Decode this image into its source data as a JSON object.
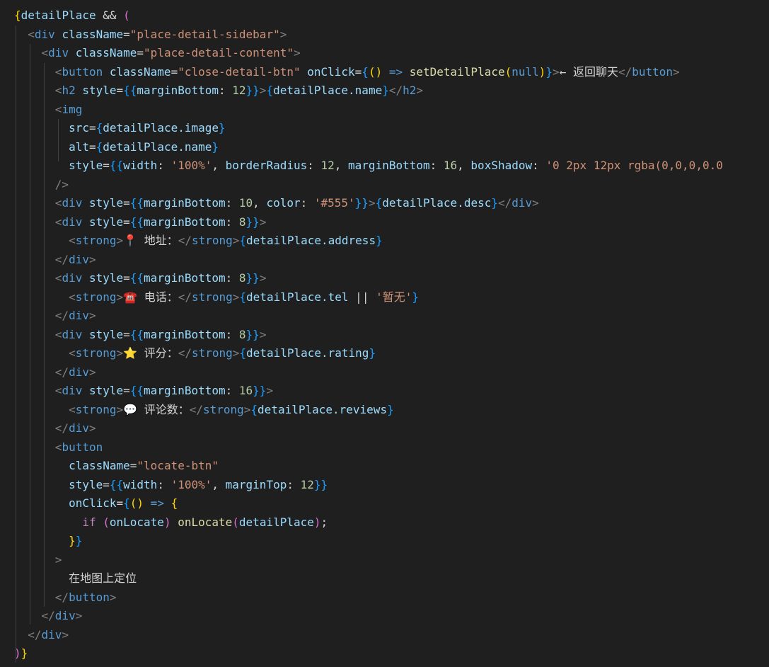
{
  "editor": {
    "lines": [
      [
        {
          "t": "{",
          "c": "tok-bracket-gold"
        },
        {
          "t": "detailPlace",
          "c": "tok-var"
        },
        {
          "t": " && ",
          "c": "tok-op"
        },
        {
          "t": "(",
          "c": "tok-bracket-pink"
        }
      ],
      [
        {
          "t": "  "
        },
        {
          "t": "<",
          "c": "tok-punct"
        },
        {
          "t": "div",
          "c": "tok-tag"
        },
        {
          "t": " className",
          "c": "tok-attr"
        },
        {
          "t": "=",
          "c": "tok-op"
        },
        {
          "t": "\"place-detail-sidebar\"",
          "c": "tok-str"
        },
        {
          "t": ">",
          "c": "tok-punct"
        }
      ],
      [
        {
          "t": "    "
        },
        {
          "t": "<",
          "c": "tok-punct"
        },
        {
          "t": "div",
          "c": "tok-tag"
        },
        {
          "t": " className",
          "c": "tok-attr"
        },
        {
          "t": "=",
          "c": "tok-op"
        },
        {
          "t": "\"place-detail-content\"",
          "c": "tok-str"
        },
        {
          "t": ">",
          "c": "tok-punct"
        }
      ],
      [
        {
          "t": "      "
        },
        {
          "t": "<",
          "c": "tok-punct"
        },
        {
          "t": "button",
          "c": "tok-tag"
        },
        {
          "t": " className",
          "c": "tok-attr"
        },
        {
          "t": "=",
          "c": "tok-op"
        },
        {
          "t": "\"close-detail-btn\"",
          "c": "tok-str"
        },
        {
          "t": " onClick",
          "c": "tok-attr"
        },
        {
          "t": "=",
          "c": "tok-op"
        },
        {
          "t": "{",
          "c": "tok-bracket-blue"
        },
        {
          "t": "()",
          "c": "tok-bracket-gold"
        },
        {
          "t": " => ",
          "c": "tok-null"
        },
        {
          "t": "setDetailPlace",
          "c": "tok-fn"
        },
        {
          "t": "(",
          "c": "tok-bracket-gold"
        },
        {
          "t": "null",
          "c": "tok-null"
        },
        {
          "t": ")",
          "c": "tok-bracket-gold"
        },
        {
          "t": "}",
          "c": "tok-bracket-blue"
        },
        {
          "t": ">",
          "c": "tok-punct"
        },
        {
          "t": "← 返回聊天",
          "c": "tok-text"
        },
        {
          "t": "</",
          "c": "tok-punct"
        },
        {
          "t": "button",
          "c": "tok-tag"
        },
        {
          "t": ">",
          "c": "tok-punct"
        }
      ],
      [
        {
          "t": "      "
        },
        {
          "t": "<",
          "c": "tok-punct"
        },
        {
          "t": "h2",
          "c": "tok-tag"
        },
        {
          "t": " style",
          "c": "tok-attr"
        },
        {
          "t": "=",
          "c": "tok-op"
        },
        {
          "t": "{{",
          "c": "tok-bracket-blue"
        },
        {
          "t": "marginBottom",
          "c": "tok-var"
        },
        {
          "t": ": ",
          "c": "tok-op"
        },
        {
          "t": "12",
          "c": "tok-num"
        },
        {
          "t": "}}",
          "c": "tok-bracket-blue"
        },
        {
          "t": ">",
          "c": "tok-punct"
        },
        {
          "t": "{",
          "c": "tok-bracket-blue"
        },
        {
          "t": "detailPlace.name",
          "c": "tok-var"
        },
        {
          "t": "}",
          "c": "tok-bracket-blue"
        },
        {
          "t": "</",
          "c": "tok-punct"
        },
        {
          "t": "h2",
          "c": "tok-tag"
        },
        {
          "t": ">",
          "c": "tok-punct"
        }
      ],
      [
        {
          "t": "      "
        },
        {
          "t": "<",
          "c": "tok-punct"
        },
        {
          "t": "img",
          "c": "tok-tag"
        }
      ],
      [
        {
          "t": "        "
        },
        {
          "t": "src",
          "c": "tok-attr"
        },
        {
          "t": "=",
          "c": "tok-op"
        },
        {
          "t": "{",
          "c": "tok-bracket-blue"
        },
        {
          "t": "detailPlace.image",
          "c": "tok-var"
        },
        {
          "t": "}",
          "c": "tok-bracket-blue"
        }
      ],
      [
        {
          "t": "        "
        },
        {
          "t": "alt",
          "c": "tok-attr"
        },
        {
          "t": "=",
          "c": "tok-op"
        },
        {
          "t": "{",
          "c": "tok-bracket-blue"
        },
        {
          "t": "detailPlace.name",
          "c": "tok-var"
        },
        {
          "t": "}",
          "c": "tok-bracket-blue"
        }
      ],
      [
        {
          "t": "        "
        },
        {
          "t": "style",
          "c": "tok-attr"
        },
        {
          "t": "=",
          "c": "tok-op"
        },
        {
          "t": "{{",
          "c": "tok-bracket-blue"
        },
        {
          "t": "width",
          "c": "tok-var"
        },
        {
          "t": ": ",
          "c": "tok-op"
        },
        {
          "t": "'100%'",
          "c": "tok-str"
        },
        {
          "t": ", ",
          "c": "tok-op"
        },
        {
          "t": "borderRadius",
          "c": "tok-var"
        },
        {
          "t": ": ",
          "c": "tok-op"
        },
        {
          "t": "12",
          "c": "tok-num"
        },
        {
          "t": ", ",
          "c": "tok-op"
        },
        {
          "t": "marginBottom",
          "c": "tok-var"
        },
        {
          "t": ": ",
          "c": "tok-op"
        },
        {
          "t": "16",
          "c": "tok-num"
        },
        {
          "t": ", ",
          "c": "tok-op"
        },
        {
          "t": "boxShadow",
          "c": "tok-var"
        },
        {
          "t": ": ",
          "c": "tok-op"
        },
        {
          "t": "'0 2px 12px rgba(0,0,0,0.0",
          "c": "tok-str"
        }
      ],
      [
        {
          "t": "      "
        },
        {
          "t": "/>",
          "c": "tok-punct"
        }
      ],
      [
        {
          "t": "      "
        },
        {
          "t": "<",
          "c": "tok-punct"
        },
        {
          "t": "div",
          "c": "tok-tag"
        },
        {
          "t": " style",
          "c": "tok-attr"
        },
        {
          "t": "=",
          "c": "tok-op"
        },
        {
          "t": "{{",
          "c": "tok-bracket-blue"
        },
        {
          "t": "marginBottom",
          "c": "tok-var"
        },
        {
          "t": ": ",
          "c": "tok-op"
        },
        {
          "t": "10",
          "c": "tok-num"
        },
        {
          "t": ", ",
          "c": "tok-op"
        },
        {
          "t": "color",
          "c": "tok-var"
        },
        {
          "t": ": ",
          "c": "tok-op"
        },
        {
          "t": "'#555'",
          "c": "tok-str"
        },
        {
          "t": "}}",
          "c": "tok-bracket-blue"
        },
        {
          "t": ">",
          "c": "tok-punct"
        },
        {
          "t": "{",
          "c": "tok-bracket-blue"
        },
        {
          "t": "detailPlace.desc",
          "c": "tok-var"
        },
        {
          "t": "}",
          "c": "tok-bracket-blue"
        },
        {
          "t": "</",
          "c": "tok-punct"
        },
        {
          "t": "div",
          "c": "tok-tag"
        },
        {
          "t": ">",
          "c": "tok-punct"
        }
      ],
      [
        {
          "t": "      "
        },
        {
          "t": "<",
          "c": "tok-punct"
        },
        {
          "t": "div",
          "c": "tok-tag"
        },
        {
          "t": " style",
          "c": "tok-attr"
        },
        {
          "t": "=",
          "c": "tok-op"
        },
        {
          "t": "{{",
          "c": "tok-bracket-blue"
        },
        {
          "t": "marginBottom",
          "c": "tok-var"
        },
        {
          "t": ": ",
          "c": "tok-op"
        },
        {
          "t": "8",
          "c": "tok-num"
        },
        {
          "t": "}}",
          "c": "tok-bracket-blue"
        },
        {
          "t": ">",
          "c": "tok-punct"
        }
      ],
      [
        {
          "t": "        "
        },
        {
          "t": "<",
          "c": "tok-punct"
        },
        {
          "t": "strong",
          "c": "tok-tag"
        },
        {
          "t": ">",
          "c": "tok-punct"
        },
        {
          "t": "📍 地址：",
          "c": "tok-text"
        },
        {
          "t": "</",
          "c": "tok-punct"
        },
        {
          "t": "strong",
          "c": "tok-tag"
        },
        {
          "t": ">",
          "c": "tok-punct"
        },
        {
          "t": "{",
          "c": "tok-bracket-blue"
        },
        {
          "t": "detailPlace.address",
          "c": "tok-var"
        },
        {
          "t": "}",
          "c": "tok-bracket-blue"
        }
      ],
      [
        {
          "t": "      "
        },
        {
          "t": "</",
          "c": "tok-punct"
        },
        {
          "t": "div",
          "c": "tok-tag"
        },
        {
          "t": ">",
          "c": "tok-punct"
        }
      ],
      [
        {
          "t": "      "
        },
        {
          "t": "<",
          "c": "tok-punct"
        },
        {
          "t": "div",
          "c": "tok-tag"
        },
        {
          "t": " style",
          "c": "tok-attr"
        },
        {
          "t": "=",
          "c": "tok-op"
        },
        {
          "t": "{{",
          "c": "tok-bracket-blue"
        },
        {
          "t": "marginBottom",
          "c": "tok-var"
        },
        {
          "t": ": ",
          "c": "tok-op"
        },
        {
          "t": "8",
          "c": "tok-num"
        },
        {
          "t": "}}",
          "c": "tok-bracket-blue"
        },
        {
          "t": ">",
          "c": "tok-punct"
        }
      ],
      [
        {
          "t": "        "
        },
        {
          "t": "<",
          "c": "tok-punct"
        },
        {
          "t": "strong",
          "c": "tok-tag"
        },
        {
          "t": ">",
          "c": "tok-punct"
        },
        {
          "t": "☎️ 电话：",
          "c": "tok-text"
        },
        {
          "t": "</",
          "c": "tok-punct"
        },
        {
          "t": "strong",
          "c": "tok-tag"
        },
        {
          "t": ">",
          "c": "tok-punct"
        },
        {
          "t": "{",
          "c": "tok-bracket-blue"
        },
        {
          "t": "detailPlace.tel",
          "c": "tok-var"
        },
        {
          "t": " || ",
          "c": "tok-op"
        },
        {
          "t": "'暂无'",
          "c": "tok-str"
        },
        {
          "t": "}",
          "c": "tok-bracket-blue"
        }
      ],
      [
        {
          "t": "      "
        },
        {
          "t": "</",
          "c": "tok-punct"
        },
        {
          "t": "div",
          "c": "tok-tag"
        },
        {
          "t": ">",
          "c": "tok-punct"
        }
      ],
      [
        {
          "t": "      "
        },
        {
          "t": "<",
          "c": "tok-punct"
        },
        {
          "t": "div",
          "c": "tok-tag"
        },
        {
          "t": " style",
          "c": "tok-attr"
        },
        {
          "t": "=",
          "c": "tok-op"
        },
        {
          "t": "{{",
          "c": "tok-bracket-blue"
        },
        {
          "t": "marginBottom",
          "c": "tok-var"
        },
        {
          "t": ": ",
          "c": "tok-op"
        },
        {
          "t": "8",
          "c": "tok-num"
        },
        {
          "t": "}}",
          "c": "tok-bracket-blue"
        },
        {
          "t": ">",
          "c": "tok-punct"
        }
      ],
      [
        {
          "t": "        "
        },
        {
          "t": "<",
          "c": "tok-punct"
        },
        {
          "t": "strong",
          "c": "tok-tag"
        },
        {
          "t": ">",
          "c": "tok-punct"
        },
        {
          "t": "⭐ 评分：",
          "c": "tok-text"
        },
        {
          "t": "</",
          "c": "tok-punct"
        },
        {
          "t": "strong",
          "c": "tok-tag"
        },
        {
          "t": ">",
          "c": "tok-punct"
        },
        {
          "t": "{",
          "c": "tok-bracket-blue"
        },
        {
          "t": "detailPlace.rating",
          "c": "tok-var"
        },
        {
          "t": "}",
          "c": "tok-bracket-blue"
        }
      ],
      [
        {
          "t": "      "
        },
        {
          "t": "</",
          "c": "tok-punct"
        },
        {
          "t": "div",
          "c": "tok-tag"
        },
        {
          "t": ">",
          "c": "tok-punct"
        }
      ],
      [
        {
          "t": "      "
        },
        {
          "t": "<",
          "c": "tok-punct"
        },
        {
          "t": "div",
          "c": "tok-tag"
        },
        {
          "t": " style",
          "c": "tok-attr"
        },
        {
          "t": "=",
          "c": "tok-op"
        },
        {
          "t": "{{",
          "c": "tok-bracket-blue"
        },
        {
          "t": "marginBottom",
          "c": "tok-var"
        },
        {
          "t": ": ",
          "c": "tok-op"
        },
        {
          "t": "16",
          "c": "tok-num"
        },
        {
          "t": "}}",
          "c": "tok-bracket-blue"
        },
        {
          "t": ">",
          "c": "tok-punct"
        }
      ],
      [
        {
          "t": "        "
        },
        {
          "t": "<",
          "c": "tok-punct"
        },
        {
          "t": "strong",
          "c": "tok-tag"
        },
        {
          "t": ">",
          "c": "tok-punct"
        },
        {
          "t": "💬 评论数：",
          "c": "tok-text"
        },
        {
          "t": "</",
          "c": "tok-punct"
        },
        {
          "t": "strong",
          "c": "tok-tag"
        },
        {
          "t": ">",
          "c": "tok-punct"
        },
        {
          "t": "{",
          "c": "tok-bracket-blue"
        },
        {
          "t": "detailPlace.reviews",
          "c": "tok-var"
        },
        {
          "t": "}",
          "c": "tok-bracket-blue"
        }
      ],
      [
        {
          "t": "      "
        },
        {
          "t": "</",
          "c": "tok-punct"
        },
        {
          "t": "div",
          "c": "tok-tag"
        },
        {
          "t": ">",
          "c": "tok-punct"
        }
      ],
      [
        {
          "t": "      "
        },
        {
          "t": "<",
          "c": "tok-punct"
        },
        {
          "t": "button",
          "c": "tok-tag"
        }
      ],
      [
        {
          "t": "        "
        },
        {
          "t": "className",
          "c": "tok-attr"
        },
        {
          "t": "=",
          "c": "tok-op"
        },
        {
          "t": "\"locate-btn\"",
          "c": "tok-str"
        }
      ],
      [
        {
          "t": "        "
        },
        {
          "t": "style",
          "c": "tok-attr"
        },
        {
          "t": "=",
          "c": "tok-op"
        },
        {
          "t": "{{",
          "c": "tok-bracket-blue"
        },
        {
          "t": "width",
          "c": "tok-var"
        },
        {
          "t": ": ",
          "c": "tok-op"
        },
        {
          "t": "'100%'",
          "c": "tok-str"
        },
        {
          "t": ", ",
          "c": "tok-op"
        },
        {
          "t": "marginTop",
          "c": "tok-var"
        },
        {
          "t": ": ",
          "c": "tok-op"
        },
        {
          "t": "12",
          "c": "tok-num"
        },
        {
          "t": "}}",
          "c": "tok-bracket-blue"
        }
      ],
      [
        {
          "t": "        "
        },
        {
          "t": "onClick",
          "c": "tok-attr"
        },
        {
          "t": "=",
          "c": "tok-op"
        },
        {
          "t": "{",
          "c": "tok-bracket-blue"
        },
        {
          "t": "()",
          "c": "tok-bracket-gold"
        },
        {
          "t": " => ",
          "c": "tok-null"
        },
        {
          "t": "{",
          "c": "tok-bracket-gold"
        }
      ],
      [
        {
          "t": "          "
        },
        {
          "t": "if",
          "c": "tok-kw"
        },
        {
          "t": " "
        },
        {
          "t": "(",
          "c": "tok-bracket-pink"
        },
        {
          "t": "onLocate",
          "c": "tok-var"
        },
        {
          "t": ")",
          "c": "tok-bracket-pink"
        },
        {
          "t": " "
        },
        {
          "t": "onLocate",
          "c": "tok-fn"
        },
        {
          "t": "(",
          "c": "tok-bracket-pink"
        },
        {
          "t": "detailPlace",
          "c": "tok-var"
        },
        {
          "t": ")",
          "c": "tok-bracket-pink"
        },
        {
          "t": ";",
          "c": "tok-op"
        }
      ],
      [
        {
          "t": "        "
        },
        {
          "t": "}",
          "c": "tok-bracket-gold"
        },
        {
          "t": "}",
          "c": "tok-bracket-blue"
        }
      ],
      [
        {
          "t": "      "
        },
        {
          "t": ">",
          "c": "tok-punct"
        }
      ],
      [
        {
          "t": "        "
        },
        {
          "t": "在地图上定位",
          "c": "tok-text"
        }
      ],
      [
        {
          "t": "      "
        },
        {
          "t": "</",
          "c": "tok-punct"
        },
        {
          "t": "button",
          "c": "tok-tag"
        },
        {
          "t": ">",
          "c": "tok-punct"
        }
      ],
      [
        {
          "t": "    "
        },
        {
          "t": "</",
          "c": "tok-punct"
        },
        {
          "t": "div",
          "c": "tok-tag"
        },
        {
          "t": ">",
          "c": "tok-punct"
        }
      ],
      [
        {
          "t": "  "
        },
        {
          "t": "</",
          "c": "tok-punct"
        },
        {
          "t": "div",
          "c": "tok-tag"
        },
        {
          "t": ">",
          "c": "tok-punct"
        }
      ],
      [
        {
          "t": ")",
          "c": "tok-bracket-pink"
        },
        {
          "t": "}",
          "c": "tok-bracket-gold"
        }
      ]
    ]
  }
}
